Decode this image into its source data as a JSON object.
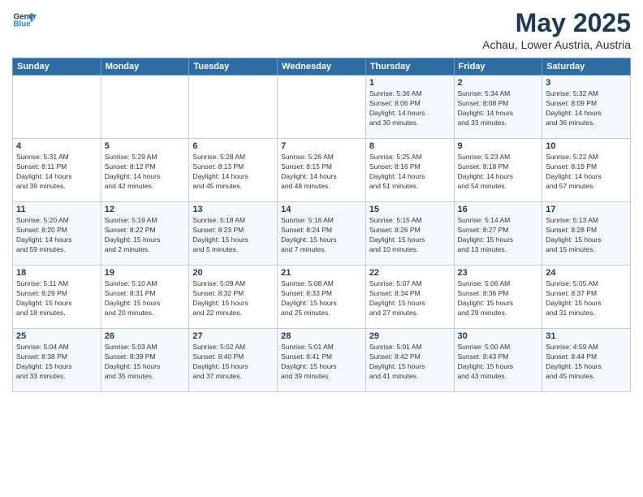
{
  "logo": {
    "line1": "General",
    "line2": "Blue"
  },
  "title": "May 2025",
  "subtitle": "Achau, Lower Austria, Austria",
  "headers": [
    "Sunday",
    "Monday",
    "Tuesday",
    "Wednesday",
    "Thursday",
    "Friday",
    "Saturday"
  ],
  "weeks": [
    [
      {
        "day": "",
        "info": ""
      },
      {
        "day": "",
        "info": ""
      },
      {
        "day": "",
        "info": ""
      },
      {
        "day": "",
        "info": ""
      },
      {
        "day": "1",
        "info": "Sunrise: 5:36 AM\nSunset: 8:06 PM\nDaylight: 14 hours\nand 30 minutes."
      },
      {
        "day": "2",
        "info": "Sunrise: 5:34 AM\nSunset: 8:08 PM\nDaylight: 14 hours\nand 33 minutes."
      },
      {
        "day": "3",
        "info": "Sunrise: 5:32 AM\nSunset: 8:09 PM\nDaylight: 14 hours\nand 36 minutes."
      }
    ],
    [
      {
        "day": "4",
        "info": "Sunrise: 5:31 AM\nSunset: 8:11 PM\nDaylight: 14 hours\nand 39 minutes."
      },
      {
        "day": "5",
        "info": "Sunrise: 5:29 AM\nSunset: 8:12 PM\nDaylight: 14 hours\nand 42 minutes."
      },
      {
        "day": "6",
        "info": "Sunrise: 5:28 AM\nSunset: 8:13 PM\nDaylight: 14 hours\nand 45 minutes."
      },
      {
        "day": "7",
        "info": "Sunrise: 5:26 AM\nSunset: 8:15 PM\nDaylight: 14 hours\nand 48 minutes."
      },
      {
        "day": "8",
        "info": "Sunrise: 5:25 AM\nSunset: 8:16 PM\nDaylight: 14 hours\nand 51 minutes."
      },
      {
        "day": "9",
        "info": "Sunrise: 5:23 AM\nSunset: 8:18 PM\nDaylight: 14 hours\nand 54 minutes."
      },
      {
        "day": "10",
        "info": "Sunrise: 5:22 AM\nSunset: 8:19 PM\nDaylight: 14 hours\nand 57 minutes."
      }
    ],
    [
      {
        "day": "11",
        "info": "Sunrise: 5:20 AM\nSunset: 8:20 PM\nDaylight: 14 hours\nand 59 minutes."
      },
      {
        "day": "12",
        "info": "Sunrise: 5:19 AM\nSunset: 8:22 PM\nDaylight: 15 hours\nand 2 minutes."
      },
      {
        "day": "13",
        "info": "Sunrise: 5:18 AM\nSunset: 8:23 PM\nDaylight: 15 hours\nand 5 minutes."
      },
      {
        "day": "14",
        "info": "Sunrise: 5:16 AM\nSunset: 8:24 PM\nDaylight: 15 hours\nand 7 minutes."
      },
      {
        "day": "15",
        "info": "Sunrise: 5:15 AM\nSunset: 8:26 PM\nDaylight: 15 hours\nand 10 minutes."
      },
      {
        "day": "16",
        "info": "Sunrise: 5:14 AM\nSunset: 8:27 PM\nDaylight: 15 hours\nand 13 minutes."
      },
      {
        "day": "17",
        "info": "Sunrise: 5:13 AM\nSunset: 8:28 PM\nDaylight: 15 hours\nand 15 minutes."
      }
    ],
    [
      {
        "day": "18",
        "info": "Sunrise: 5:11 AM\nSunset: 8:29 PM\nDaylight: 15 hours\nand 18 minutes."
      },
      {
        "day": "19",
        "info": "Sunrise: 5:10 AM\nSunset: 8:31 PM\nDaylight: 15 hours\nand 20 minutes."
      },
      {
        "day": "20",
        "info": "Sunrise: 5:09 AM\nSunset: 8:32 PM\nDaylight: 15 hours\nand 22 minutes."
      },
      {
        "day": "21",
        "info": "Sunrise: 5:08 AM\nSunset: 8:33 PM\nDaylight: 15 hours\nand 25 minutes."
      },
      {
        "day": "22",
        "info": "Sunrise: 5:07 AM\nSunset: 8:34 PM\nDaylight: 15 hours\nand 27 minutes."
      },
      {
        "day": "23",
        "info": "Sunrise: 5:06 AM\nSunset: 8:36 PM\nDaylight: 15 hours\nand 29 minutes."
      },
      {
        "day": "24",
        "info": "Sunrise: 5:05 AM\nSunset: 8:37 PM\nDaylight: 15 hours\nand 31 minutes."
      }
    ],
    [
      {
        "day": "25",
        "info": "Sunrise: 5:04 AM\nSunset: 8:38 PM\nDaylight: 15 hours\nand 33 minutes."
      },
      {
        "day": "26",
        "info": "Sunrise: 5:03 AM\nSunset: 8:39 PM\nDaylight: 15 hours\nand 35 minutes."
      },
      {
        "day": "27",
        "info": "Sunrise: 5:02 AM\nSunset: 8:40 PM\nDaylight: 15 hours\nand 37 minutes."
      },
      {
        "day": "28",
        "info": "Sunrise: 5:01 AM\nSunset: 8:41 PM\nDaylight: 15 hours\nand 39 minutes."
      },
      {
        "day": "29",
        "info": "Sunrise: 5:01 AM\nSunset: 8:42 PM\nDaylight: 15 hours\nand 41 minutes."
      },
      {
        "day": "30",
        "info": "Sunrise: 5:00 AM\nSunset: 8:43 PM\nDaylight: 15 hours\nand 43 minutes."
      },
      {
        "day": "31",
        "info": "Sunrise: 4:59 AM\nSunset: 8:44 PM\nDaylight: 15 hours\nand 45 minutes."
      }
    ]
  ]
}
